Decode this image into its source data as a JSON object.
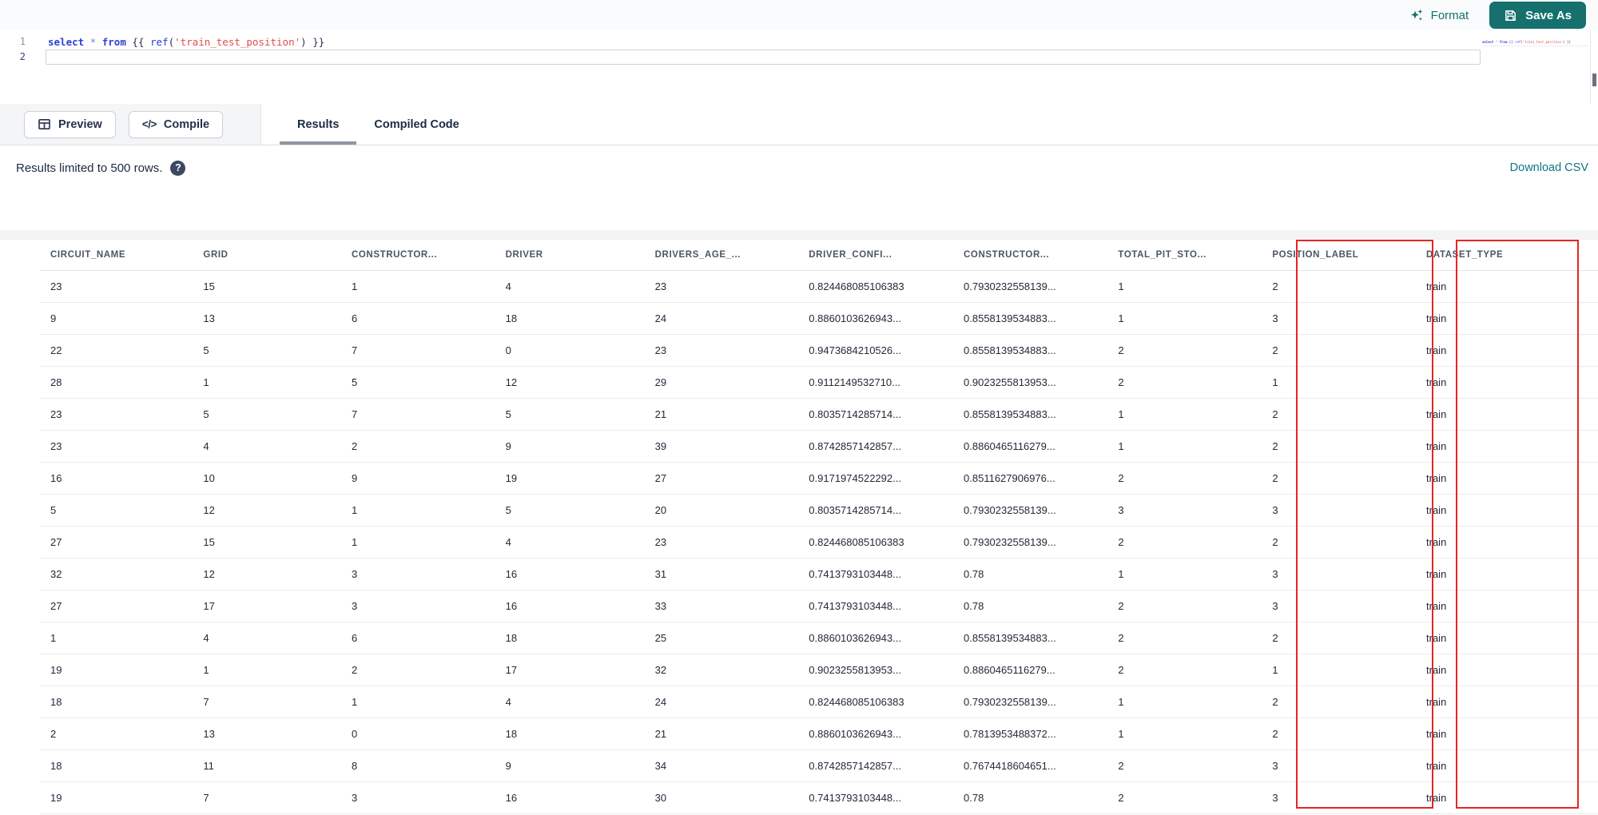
{
  "editor": {
    "toolbar": {
      "format_label": "Format",
      "save_as_label": "Save As"
    },
    "code": {
      "lines": [
        {
          "number": "1",
          "active": false,
          "tokens": [
            {
              "text": "select",
              "type": "kw"
            },
            {
              "text": " ",
              "type": "plain"
            },
            {
              "text": "*",
              "type": "star"
            },
            {
              "text": " ",
              "type": "plain"
            },
            {
              "text": "from",
              "type": "kw"
            },
            {
              "text": " ",
              "type": "plain"
            },
            {
              "text": "{{",
              "type": "brace"
            },
            {
              "text": " ",
              "type": "plain"
            },
            {
              "text": "ref",
              "type": "fn"
            },
            {
              "text": "(",
              "type": "brace"
            },
            {
              "text": "'train_test_position'",
              "type": "str"
            },
            {
              "text": ")",
              "type": "brace"
            },
            {
              "text": " ",
              "type": "plain"
            },
            {
              "text": "}}",
              "type": "brace"
            }
          ]
        },
        {
          "number": "2",
          "active": true,
          "tokens": []
        }
      ]
    }
  },
  "actions": {
    "preview_label": "Preview",
    "compile_label": "Compile",
    "compile_glyph": "</>"
  },
  "tabs": [
    {
      "label": "Results",
      "active": true
    },
    {
      "label": "Compiled Code",
      "active": false
    }
  ],
  "results": {
    "limit_text": "Results limited to 500 rows.",
    "help_icon": "question-mark-circle-icon",
    "download_label": "Download CSV"
  },
  "table": {
    "columns": [
      "CIRCUIT_NAME",
      "GRID",
      "CONSTRUCTOR...",
      "DRIVER",
      "DRIVERS_AGE_...",
      "DRIVER_CONFI...",
      "CONSTRUCTOR...",
      "TOTAL_PIT_STO...",
      "POSITION_LABEL",
      "DATASET_TYPE"
    ],
    "rows": [
      [
        "23",
        "15",
        "1",
        "4",
        "23",
        "0.824468085106383",
        "0.7930232558139...",
        "1",
        "2",
        "train"
      ],
      [
        "9",
        "13",
        "6",
        "18",
        "24",
        "0.8860103626943...",
        "0.8558139534883...",
        "1",
        "3",
        "train"
      ],
      [
        "22",
        "5",
        "7",
        "0",
        "23",
        "0.9473684210526...",
        "0.8558139534883...",
        "2",
        "2",
        "train"
      ],
      [
        "28",
        "1",
        "5",
        "12",
        "29",
        "0.9112149532710...",
        "0.9023255813953...",
        "2",
        "1",
        "train"
      ],
      [
        "23",
        "5",
        "7",
        "5",
        "21",
        "0.8035714285714...",
        "0.8558139534883...",
        "1",
        "2",
        "train"
      ],
      [
        "23",
        "4",
        "2",
        "9",
        "39",
        "0.8742857142857...",
        "0.8860465116279...",
        "1",
        "2",
        "train"
      ],
      [
        "16",
        "10",
        "9",
        "19",
        "27",
        "0.9171974522292...",
        "0.8511627906976...",
        "2",
        "2",
        "train"
      ],
      [
        "5",
        "12",
        "1",
        "5",
        "20",
        "0.8035714285714...",
        "0.7930232558139...",
        "3",
        "3",
        "train"
      ],
      [
        "27",
        "15",
        "1",
        "4",
        "23",
        "0.824468085106383",
        "0.7930232558139...",
        "2",
        "2",
        "train"
      ],
      [
        "32",
        "12",
        "3",
        "16",
        "31",
        "0.7413793103448...",
        "0.78",
        "1",
        "3",
        "train"
      ],
      [
        "27",
        "17",
        "3",
        "16",
        "33",
        "0.7413793103448...",
        "0.78",
        "2",
        "3",
        "train"
      ],
      [
        "1",
        "4",
        "6",
        "18",
        "25",
        "0.8860103626943...",
        "0.8558139534883...",
        "2",
        "2",
        "train"
      ],
      [
        "19",
        "1",
        "2",
        "17",
        "32",
        "0.9023255813953...",
        "0.8860465116279...",
        "2",
        "1",
        "train"
      ],
      [
        "18",
        "7",
        "1",
        "4",
        "24",
        "0.824468085106383",
        "0.7930232558139...",
        "1",
        "2",
        "train"
      ],
      [
        "2",
        "13",
        "0",
        "18",
        "21",
        "0.8860103626943...",
        "0.7813953488372...",
        "1",
        "2",
        "train"
      ],
      [
        "18",
        "11",
        "8",
        "9",
        "34",
        "0.8742857142857...",
        "0.7674418604651...",
        "2",
        "3",
        "train"
      ],
      [
        "19",
        "7",
        "3",
        "16",
        "30",
        "0.7413793103448...",
        "0.78",
        "2",
        "3",
        "train"
      ]
    ],
    "highlighted_columns": [
      "POSITION_LABEL",
      "DATASET_TYPE"
    ]
  },
  "colors": {
    "accent_teal": "#15706e",
    "link_teal": "#0d7583",
    "highlight_red": "#e82420",
    "keyword_blue": "#2c3ed8",
    "string_red": "#de4f49"
  }
}
